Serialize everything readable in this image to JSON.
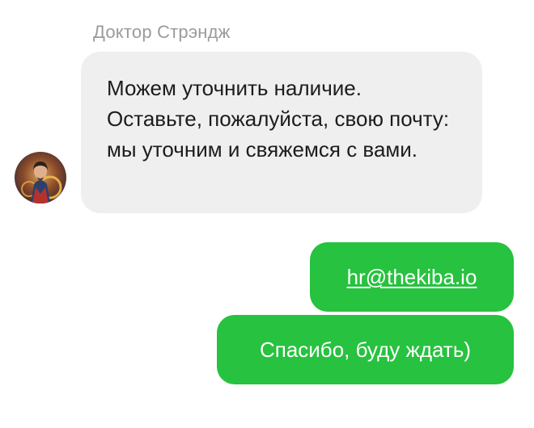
{
  "chat": {
    "sender_name": "Доктор Стрэндж",
    "avatar_icon": "character-portrait-icon",
    "incoming_message": "Можем уточнить наличие. Оставьте, пожалуйста, свою почту: мы уточним и свяжемся с вами.",
    "outgoing_messages": [
      {
        "text": "hr@thekiba.io",
        "is_link": true
      },
      {
        "text": "Спасибо, буду ждать)"
      }
    ]
  },
  "colors": {
    "incoming_bubble": "#efeff0",
    "outgoing_bubble": "#27c23f",
    "sender_name": "#9a9aa0"
  }
}
